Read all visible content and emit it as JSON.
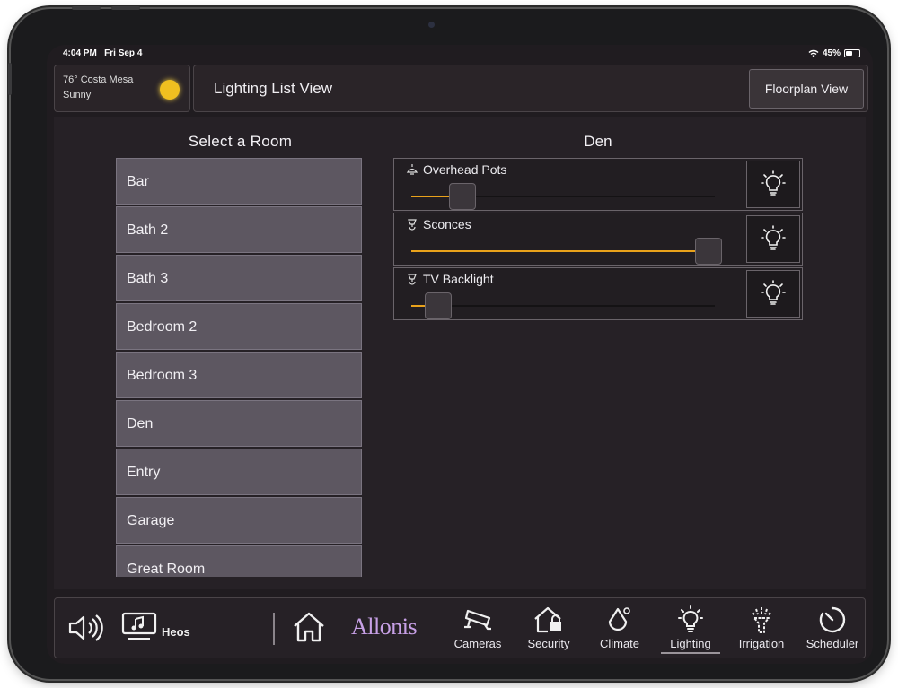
{
  "status_bar": {
    "time": "4:04 PM",
    "date": "Fri Sep 4",
    "battery": "45%"
  },
  "weather": {
    "location": "76° Costa Mesa",
    "condition": "Sunny"
  },
  "header": {
    "title": "Lighting List View",
    "floorplan_button": "Floorplan View"
  },
  "rooms": {
    "heading": "Select a Room",
    "items": [
      "Bar",
      "Bath 2",
      "Bath 3",
      "Bedroom 2",
      "Bedroom 3",
      "Den",
      "Entry",
      "Garage",
      "Great Room"
    ]
  },
  "den": {
    "heading": "Den",
    "lights": [
      {
        "name": "Overhead Pots",
        "level": 0.17,
        "icon": "ceiling-pendant-icon"
      },
      {
        "name": "Sconces",
        "level": 0.98,
        "icon": "sconce-icon"
      },
      {
        "name": "TV Backlight",
        "level": 0.09,
        "icon": "sconce-icon"
      }
    ]
  },
  "bottom_nav": {
    "heos_label": "Heos",
    "brand": "Allonis",
    "items": [
      {
        "label": "Cameras",
        "icon": "camera-icon"
      },
      {
        "label": "Security",
        "icon": "house-lock-icon"
      },
      {
        "label": "Climate",
        "icon": "drop-icon"
      },
      {
        "label": "Lighting",
        "icon": "lightbulb-icon",
        "active": true
      },
      {
        "label": "Irrigation",
        "icon": "sprinkler-icon"
      },
      {
        "label": "Scheduler",
        "icon": "timer-icon"
      }
    ]
  },
  "colors": {
    "accent": "#e9a21b",
    "background": "#201c20",
    "list_item": "#5d5761",
    "brand": "#c7a0e6"
  }
}
